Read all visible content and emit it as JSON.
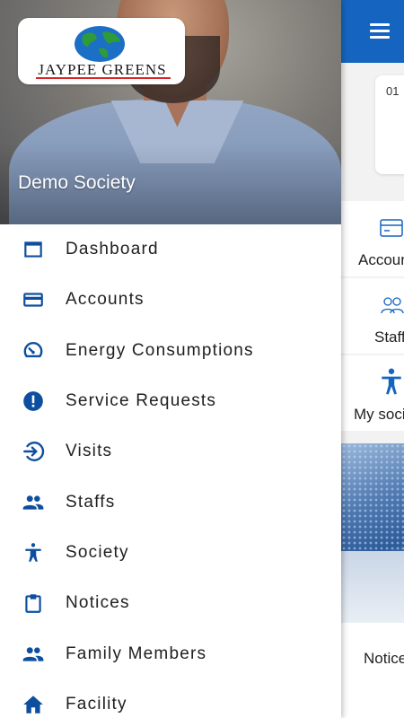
{
  "drawer": {
    "logo_text": "JAYPEE GREENS",
    "society_name": "Demo Society",
    "menu": [
      {
        "label": "Dashboard",
        "icon": "dashboard-icon"
      },
      {
        "label": "Accounts",
        "icon": "credit-card-icon"
      },
      {
        "label": "Energy Consumptions",
        "icon": "gauge-icon"
      },
      {
        "label": "Service Requests",
        "icon": "alert-circle-icon"
      },
      {
        "label": "Visits",
        "icon": "login-arrow-icon"
      },
      {
        "label": "Staffs",
        "icon": "people-icon"
      },
      {
        "label": "Society",
        "icon": "accessibility-icon"
      },
      {
        "label": "Notices",
        "icon": "clipboard-icon"
      },
      {
        "label": "Family Members",
        "icon": "group-icon"
      },
      {
        "label": "Facility",
        "icon": "home-icon"
      }
    ]
  },
  "main": {
    "date_fragment": "01",
    "tiles": [
      {
        "label": "Accounts"
      },
      {
        "label": "Staffs"
      },
      {
        "label": "My society"
      }
    ],
    "notices_label": "Notices"
  },
  "colors": {
    "primary": "#1565c0",
    "icon": "#0d4f9e",
    "logo_red": "#d9252a"
  }
}
